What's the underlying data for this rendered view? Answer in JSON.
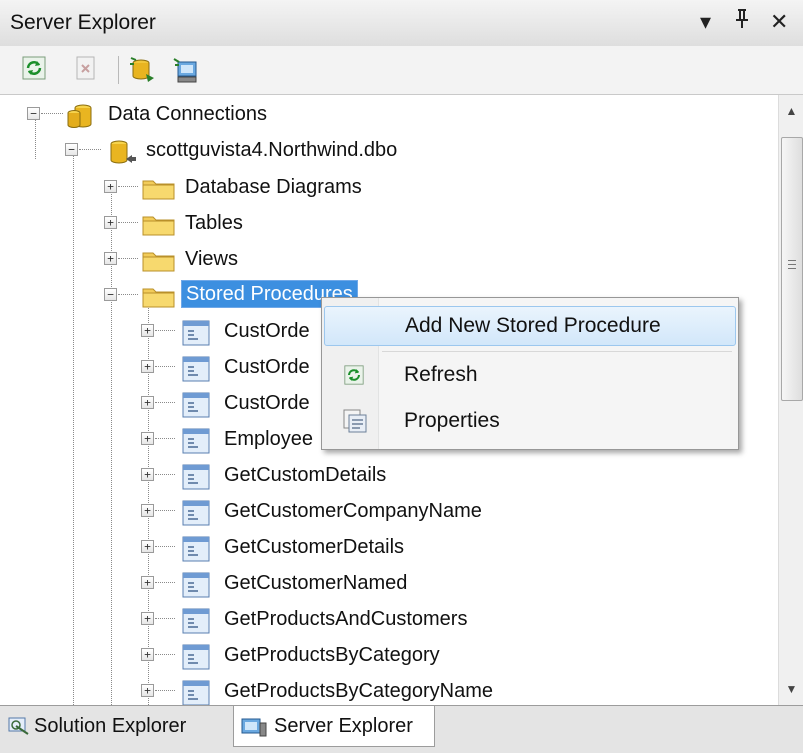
{
  "window": {
    "title": "Server Explorer",
    "buttons": {
      "dropdown": "▾",
      "pin": "ᛜ",
      "close": "✕"
    }
  },
  "toolbar": {
    "items": [
      "refresh-icon",
      "stop-icon",
      "connect-to-database-icon",
      "connect-to-server-icon"
    ]
  },
  "tree": {
    "root": "Data Connections",
    "connection": "scottguvista4.Northwind.dbo",
    "folders": [
      "Database Diagrams",
      "Tables",
      "Views",
      "Stored Procedures"
    ],
    "selected_folder": "Stored Procedures",
    "procedures": [
      "CustOrde",
      "CustOrde",
      "CustOrde",
      "Employee",
      "GetCustomDetails",
      "GetCustomerCompanyName",
      "GetCustomerDetails",
      "GetCustomerNamed",
      "GetProductsAndCustomers",
      "GetProductsByCategory",
      "GetProductsByCategoryName"
    ]
  },
  "context_menu": {
    "items": [
      {
        "label": "Add New Stored Procedure",
        "icon": "",
        "highlighted": true
      },
      {
        "label": "Refresh",
        "icon": "refresh-icon",
        "highlighted": false
      },
      {
        "label": "Properties",
        "icon": "properties-icon",
        "highlighted": false
      }
    ]
  },
  "tabs": [
    {
      "label": "Solution Explorer",
      "icon": "solution-explorer-icon",
      "active": false
    },
    {
      "label": "Server Explorer",
      "icon": "server-explorer-icon",
      "active": true
    }
  ],
  "colors": {
    "selection": "#3c8fe0",
    "menu_hover": "#d2e7fa"
  }
}
